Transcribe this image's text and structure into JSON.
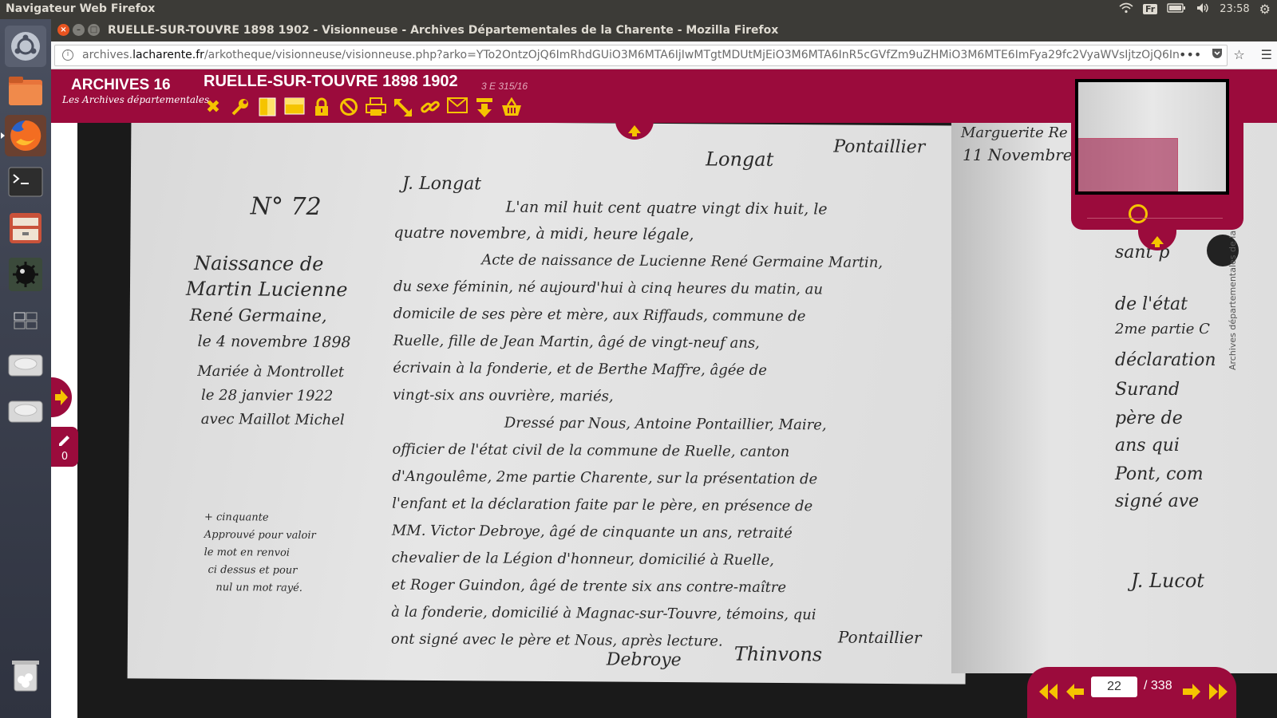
{
  "system": {
    "app_title": "Navigateur Web Firefox",
    "keyboard_layout": "Fr",
    "clock": "23:58"
  },
  "window": {
    "title": "RUELLE-SUR-TOUVRE 1898 1902 - Visionneuse - Archives Départementales de la Charente - Mozilla Firefox"
  },
  "urlbar": {
    "domain_prefix": "archives.",
    "domain": "lacharente.fr",
    "path": "/arkotheque/visionneuse/visionneuse.php?arko=YTo2OntzOjQ6ImRhdGUiO3M6MTA6IjIwMTgtMDUtMjEiO3M6MTA6InR5cGVfZm9uZHMiO3M6MTE6ImFya29fc2VyaWVsIjtzOjQ6In"
  },
  "viewer": {
    "logo_title": "ARCHIVES 16",
    "logo_subtitle": "Les Archives départementales",
    "document_title": "RUELLE-SUR-TOUVRE 1898 1902",
    "cote": "3 E 315/16",
    "notes_count": "0",
    "toolbar_icons": [
      "close-icon",
      "wrench-icon",
      "contrast-icon",
      "brightness-icon",
      "lock-icon",
      "reset-icon",
      "print-icon",
      "resize-icon",
      "link-icon",
      "mail-icon",
      "download-icon",
      "basket-icon"
    ],
    "watermark": "Archives départementales de la Charente",
    "pager": {
      "current_page": "22",
      "total": "/ 338"
    }
  },
  "document_text": {
    "entry_number": "N° 72",
    "margin_line1": "Naissance de",
    "margin_line2": "Martin Lucienne",
    "margin_line3": "René Germaine,",
    "margin_line4": "le 4 novembre 1898",
    "marriage1": "Mariée à Montrollet",
    "marriage2": "le 28 janvier 1922",
    "marriage3": "avec Maillot Michel",
    "footnote1": "+ cinquante",
    "footnote2": "Approuvé pour valoir",
    "footnote3": "le mot en renvoi",
    "footnote4": "ci dessus et pour",
    "footnote5": "nul un mot rayé.",
    "sig_top": "J. Longat",
    "sig_top2": "Longat",
    "sig_top3": "Pontaillier",
    "body1": "L'an mil huit cent quatre vingt dix huit, le",
    "body2": "quatre novembre, à midi, heure légale,",
    "body3": "Acte de naissance de Lucienne René Germaine Martin,",
    "body4": "du sexe féminin, né aujourd'hui à cinq heures du matin, au",
    "body5": "domicile de ses père et mère, aux Riffauds, commune de",
    "body6": "Ruelle, fille de Jean Martin, âgé de vingt-neuf ans,",
    "body7": "écrivain à la fonderie, et de Berthe Maffre, âgée de",
    "body8": "vingt-six ans ouvrière, mariés,",
    "body9": "Dressé par Nous, Antoine Pontaillier, Maire,",
    "body10": "officier de l'état civil de la commune de Ruelle, canton",
    "body11": "d'Angoulême, 2me partie Charente, sur la présentation de",
    "body12": "l'enfant et la déclaration faite par le père, en présence de",
    "body13": "MM. Victor Debroye, âgé de cinquante un ans, retraité",
    "body14": "chevalier de la Légion d'honneur, domicilié à Ruelle,",
    "body15": "et Roger Guindon, âgé de trente six ans contre-maître",
    "body16": "à la fonderie, domicilié à Magnac-sur-Touvre, témoins, qui",
    "body17": "ont signé avec le père et Nous, après lecture.",
    "right1": "Marguerite Re",
    "right2": "11 Novembre",
    "right3": "sant p",
    "right4": "de l'état",
    "right5": "2me partie C",
    "right6": "déclaration",
    "right7": "Surand",
    "right8": "père de",
    "right9": "ans qui",
    "right10": "Pont, com",
    "right11": "signé ave",
    "right12": "J. Lucot",
    "sig_bottom1": "Debroye",
    "sig_bottom2": "Thinvons",
    "sig_bottom3": "Pontaillier"
  }
}
